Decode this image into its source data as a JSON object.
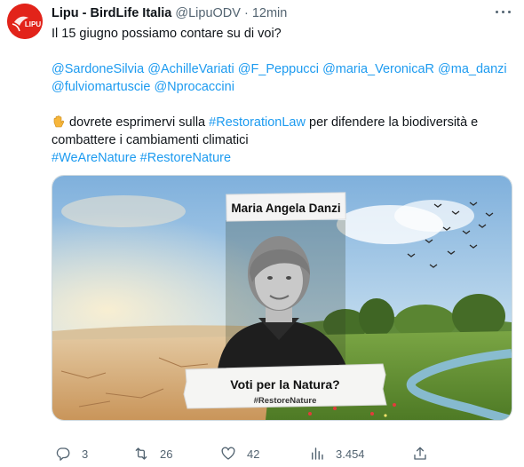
{
  "tweet": {
    "author_name": "Lipu - BirdLife Italia",
    "handle": "@LipuODV",
    "separator": "·",
    "time": "12min",
    "avatar_text": "LIPU",
    "line1": "Il 15 giugno possiamo contare su di voi?",
    "mentions": [
      "@SardoneSilvia",
      "@AchilleVariati",
      "@F_Peppucci",
      "@maria_VeronicaR",
      "@ma_danzi",
      "@fulviomartuscie",
      "@Nprocaccini"
    ],
    "body2_a": "dovrete esprimervi sulla",
    "hashtag_restoration": "#RestorationLaw",
    "body2_b": "per difendere la biodiversità e",
    "line4": "combattere i cambiamenti climatici",
    "hashtags": [
      "#WeAreNature",
      "#RestoreNature"
    ],
    "emoji_icon": "raised-hand-emoji"
  },
  "media": {
    "person_label": "Maria Angela Danzi",
    "caption": "Voti per la Natura?",
    "caption_tag": "#RestoreNature",
    "colors": {
      "sky": "#9fc6e6",
      "ground_dry": "#d8b27c",
      "grass": "#6f9a3a",
      "river": "#7fb2d6"
    }
  },
  "actions": {
    "reply": {
      "icon": "reply-icon",
      "count": "3"
    },
    "retweet": {
      "icon": "retweet-icon",
      "count": "26"
    },
    "like": {
      "icon": "heart-icon",
      "count": "42"
    },
    "views": {
      "icon": "views-icon",
      "count": "3.454"
    },
    "share": {
      "icon": "share-icon",
      "count": ""
    }
  },
  "colors": {
    "link": "#1d9bf0",
    "muted": "#536471",
    "brand": "#e2231a"
  }
}
